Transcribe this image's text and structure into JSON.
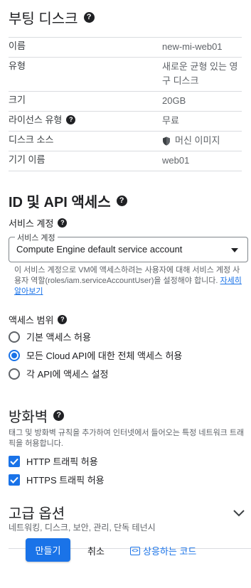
{
  "boot_disk": {
    "title": "부팅 디스크",
    "rows": [
      {
        "key": "이름",
        "value": "new-mi-web01"
      },
      {
        "key": "유형",
        "value": "새로운 균형 있는 영구 디스크"
      },
      {
        "key": "크기",
        "value": "20GB"
      },
      {
        "key": "라이선스 유형",
        "value": "무료"
      },
      {
        "key": "디스크 소스",
        "value": "머신 이미지"
      },
      {
        "key": "기기 이름",
        "value": "web01"
      }
    ]
  },
  "identity": {
    "title": "ID 및 API 액세스",
    "service_account_label": "서비스 계정",
    "select_legend": "서비스 계정",
    "select_value": "Compute Engine default service account",
    "helper_text": "이 서비스 계정으로 VM에 액세스하려는 사용자에 대해 서비스 계정 사용자 역할(roles/iam.serviceAccountUser)을 설정해야 합니다.",
    "helper_link": "자세히 알아보기",
    "access_scope_label": "액세스 범위",
    "scopes": [
      {
        "label": "기본 액세스 허용",
        "checked": false
      },
      {
        "label": "모든 Cloud API에 대한 전체 액세스 허용",
        "checked": true
      },
      {
        "label": "각 API에 액세스 설정",
        "checked": false
      }
    ]
  },
  "firewall": {
    "title": "방화벽",
    "description": "태그 및 방화벽 규칙을 추가하여 인터넷에서 들어오는 특정 네트워크 트래픽을 허용합니다.",
    "options": [
      {
        "label": "HTTP 트래픽 허용",
        "checked": true
      },
      {
        "label": "HTTPS 트래픽 허용",
        "checked": true
      }
    ]
  },
  "advanced": {
    "title": "고급 옵션",
    "subtitle": "네트워킹, 디스크, 보안, 관리, 단독 테넌시"
  },
  "actions": {
    "create_label": "만들기",
    "cancel_label": "취소",
    "code_label": "상응하는 코드"
  },
  "colors": {
    "accent": "#1a73e8",
    "text": "#202124",
    "muted": "#5f6368",
    "border": "#dadce0"
  },
  "icons": {
    "help": "help-icon",
    "shield": "shield-icon",
    "dropdown": "dropdown-arrow-icon",
    "chevron": "chevron-down-icon",
    "code": "code-icon"
  }
}
